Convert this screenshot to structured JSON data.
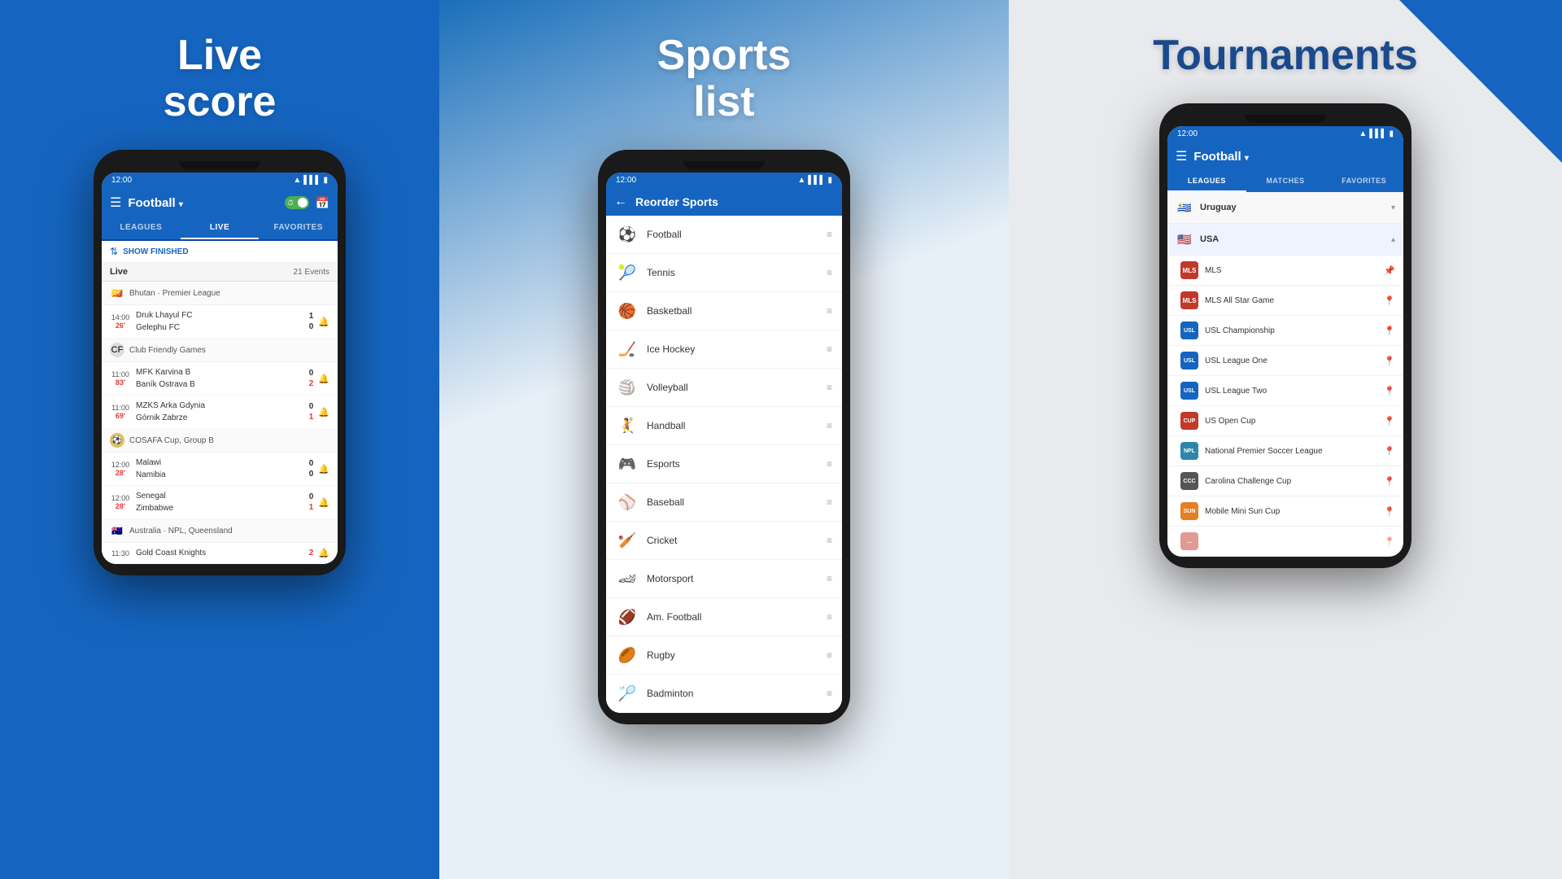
{
  "sections": {
    "left": {
      "title": "Live\nscore",
      "phone": {
        "status_time": "12:00",
        "header": {
          "sport": "Football",
          "dropdown": true
        },
        "tabs": [
          "LEAGUES",
          "LIVE",
          "FAVORITES"
        ],
        "active_tab": "LIVE",
        "show_finished_label": "SHOW FINISHED",
        "live_label": "Live",
        "events_count": "21 Events",
        "leagues": [
          {
            "flag": "🇧🇹",
            "name": "Bhutan · Premier League",
            "matches": [
              {
                "time_start": "14:00",
                "time_live": "26'",
                "team1": "Druk Lhayul FC",
                "team2": "Gelephu FC",
                "score1": "1",
                "score2": "0"
              }
            ]
          },
          {
            "flag": "🌍",
            "name": "Club Friendly Games",
            "matches": [
              {
                "time_start": "11:00",
                "time_live": "83'",
                "team1": "MFK Karvina B",
                "team2": "Baník Ostrava B",
                "score1": "0",
                "score2": "2"
              },
              {
                "time_start": "11:00",
                "time_live": "69'",
                "team1": "MZKS Arka Gdynia",
                "team2": "Górnik Zabrze",
                "score1": "0",
                "score2": "1"
              }
            ]
          },
          {
            "flag": "🌍",
            "name": "COSAFA Cup, Group B",
            "matches": [
              {
                "time_start": "12:00",
                "time_live": "28'",
                "team1": "Malawi",
                "team2": "Namibia",
                "score1": "0",
                "score2": "0"
              },
              {
                "time_start": "12:00",
                "time_live": "28'",
                "team1": "Senegal",
                "team2": "Zimbabwe",
                "score1": "0",
                "score2": "1"
              }
            ]
          },
          {
            "flag": "🇦🇺",
            "name": "Australia · NPL, Queensland",
            "matches": [
              {
                "time_start": "11:30",
                "time_live": "",
                "team1": "Gold Coast Knights",
                "team2": "",
                "score1": "2",
                "score2": ""
              }
            ]
          }
        ]
      }
    },
    "mid": {
      "title": "Sports\nlist",
      "phone": {
        "status_time": "12:00",
        "header_title": "Reorder Sports",
        "sports": [
          {
            "icon": "⚽",
            "name": "Football"
          },
          {
            "icon": "🎾",
            "name": "Tennis"
          },
          {
            "icon": "🏀",
            "name": "Basketball"
          },
          {
            "icon": "🏒",
            "name": "Ice Hockey"
          },
          {
            "icon": "🏐",
            "name": "Volleyball"
          },
          {
            "icon": "🤾",
            "name": "Handball"
          },
          {
            "icon": "🎮",
            "name": "Esports"
          },
          {
            "icon": "⚾",
            "name": "Baseball"
          },
          {
            "icon": "🏏",
            "name": "Cricket"
          },
          {
            "icon": "🏎",
            "name": "Motorsport"
          },
          {
            "icon": "🏈",
            "name": "Am. Football"
          },
          {
            "icon": "🏉",
            "name": "Rugby"
          },
          {
            "icon": "🏸",
            "name": "Badminton"
          }
        ]
      }
    },
    "right": {
      "title": "Tournaments",
      "phone": {
        "status_time": "12:00",
        "header": {
          "sport": "Football",
          "dropdown": true
        },
        "tabs": [
          "LEAGUES",
          "MATCHES",
          "FAVORITES"
        ],
        "active_tab": "LEAGUES",
        "countries": [
          {
            "flag": "🇺🇾",
            "name": "Uruguay",
            "expanded": false,
            "leagues": []
          },
          {
            "flag": "🇺🇸",
            "name": "USA",
            "expanded": true,
            "leagues": [
              {
                "abbr": "MLS",
                "color": "#c0392b",
                "name": "MLS",
                "pinned": true
              },
              {
                "abbr": "MLS",
                "color": "#c0392b",
                "name": "MLS All Star Game",
                "pinned": false
              },
              {
                "abbr": "USL",
                "color": "#1565c0",
                "name": "USL Championship",
                "pinned": false
              },
              {
                "abbr": "USL",
                "color": "#1565c0",
                "name": "USL League One",
                "pinned": false
              },
              {
                "abbr": "USL",
                "color": "#1565c0",
                "name": "USL League Two",
                "pinned": false
              },
              {
                "abbr": "CUP",
                "color": "#c0392b",
                "name": "US Open Cup",
                "pinned": false
              },
              {
                "abbr": "NPL",
                "color": "#2e86ab",
                "name": "National Premier Soccer League",
                "pinned": false
              },
              {
                "abbr": "CCC",
                "color": "#555",
                "name": "Carolina Challenge Cup",
                "pinned": false
              },
              {
                "abbr": "SUN",
                "color": "#e67e22",
                "name": "Mobile Mini Sun Cup",
                "pinned": false
              }
            ]
          }
        ]
      }
    }
  }
}
